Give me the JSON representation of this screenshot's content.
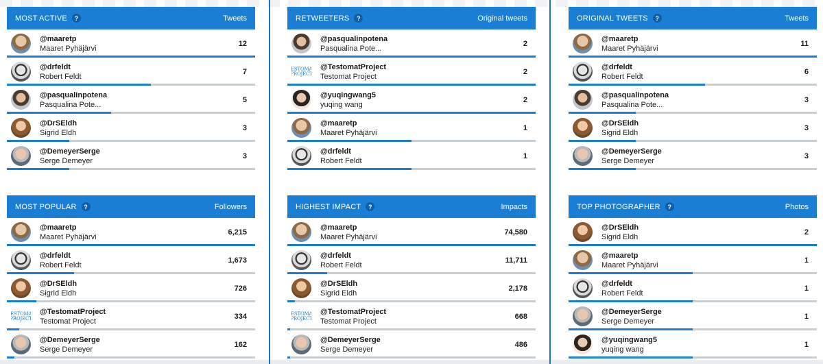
{
  "panels": [
    {
      "title": "MOST ACTIVE",
      "metric": "Tweets",
      "rows": [
        {
          "handle": "@maaretp",
          "name": "Maaret Pyhäjärvi",
          "value": "12",
          "fill": 1.0,
          "avatar": "a1"
        },
        {
          "handle": "@drfeldt",
          "name": "Robert Feldt",
          "value": "7",
          "fill": 0.58,
          "avatar": "a2"
        },
        {
          "handle": "@pasqualinpotena",
          "name": "Pasqualina Pote...",
          "value": "5",
          "fill": 0.42,
          "avatar": "a3"
        },
        {
          "handle": "@DrSEldh",
          "name": "Sigrid Eldh",
          "value": "3",
          "fill": 0.25,
          "avatar": "a4"
        },
        {
          "handle": "@DemeyerSerge",
          "name": "Serge Demeyer",
          "value": "3",
          "fill": 0.25,
          "avatar": "a5"
        }
      ]
    },
    {
      "title": "RETWEETERS",
      "metric": "Original tweets",
      "rows": [
        {
          "handle": "@pasqualinpotena",
          "name": "Pasqualina Pote...",
          "value": "2",
          "fill": 1.0,
          "avatar": "a3"
        },
        {
          "handle": "@TestomatProject",
          "name": "Testomat Project",
          "value": "2",
          "fill": 1.0,
          "avatar": "logo"
        },
        {
          "handle": "@yuqingwang5",
          "name": "yuqing wang",
          "value": "2",
          "fill": 1.0,
          "avatar": "a6"
        },
        {
          "handle": "@maaretp",
          "name": "Maaret Pyhäjärvi",
          "value": "1",
          "fill": 0.5,
          "avatar": "a1"
        },
        {
          "handle": "@drfeldt",
          "name": "Robert Feldt",
          "value": "1",
          "fill": 0.5,
          "avatar": "a2"
        }
      ]
    },
    {
      "title": "ORIGINAL TWEETS",
      "metric": "Tweets",
      "rows": [
        {
          "handle": "@maaretp",
          "name": "Maaret Pyhäjärvi",
          "value": "11",
          "fill": 1.0,
          "avatar": "a1"
        },
        {
          "handle": "@drfeldt",
          "name": "Robert Feldt",
          "value": "6",
          "fill": 0.55,
          "avatar": "a2"
        },
        {
          "handle": "@pasqualinpotena",
          "name": "Pasqualina Pote...",
          "value": "3",
          "fill": 0.27,
          "avatar": "a3"
        },
        {
          "handle": "@DrSEldh",
          "name": "Sigrid Eldh",
          "value": "3",
          "fill": 0.27,
          "avatar": "a4"
        },
        {
          "handle": "@DemeyerSerge",
          "name": "Serge Demeyer",
          "value": "3",
          "fill": 0.27,
          "avatar": "a5"
        }
      ]
    },
    {
      "title": "MOST POPULAR",
      "metric": "Followers",
      "rows": [
        {
          "handle": "@maaretp",
          "name": "Maaret Pyhäjärvi",
          "value": "6,215",
          "fill": 1.0,
          "avatar": "a1"
        },
        {
          "handle": "@drfeldt",
          "name": "Robert Feldt",
          "value": "1,673",
          "fill": 0.27,
          "avatar": "a2"
        },
        {
          "handle": "@DrSEldh",
          "name": "Sigrid Eldh",
          "value": "726",
          "fill": 0.12,
          "avatar": "a4"
        },
        {
          "handle": "@TestomatProject",
          "name": "Testomat Project",
          "value": "334",
          "fill": 0.05,
          "avatar": "logo"
        },
        {
          "handle": "@DemeyerSerge",
          "name": "Serge Demeyer",
          "value": "162",
          "fill": 0.03,
          "avatar": "a5"
        }
      ]
    },
    {
      "title": "HIGHEST IMPACT",
      "metric": "Impacts",
      "rows": [
        {
          "handle": "@maaretp",
          "name": "Maaret Pyhäjärvi",
          "value": "74,580",
          "fill": 1.0,
          "avatar": "a1"
        },
        {
          "handle": "@drfeldt",
          "name": "Robert Feldt",
          "value": "11,711",
          "fill": 0.16,
          "avatar": "a2"
        },
        {
          "handle": "@DrSEldh",
          "name": "Sigrid Eldh",
          "value": "2,178",
          "fill": 0.03,
          "avatar": "a4"
        },
        {
          "handle": "@TestomatProject",
          "name": "Testomat Project",
          "value": "668",
          "fill": 0.01,
          "avatar": "logo"
        },
        {
          "handle": "@DemeyerSerge",
          "name": "Serge Demeyer",
          "value": "486",
          "fill": 0.01,
          "avatar": "a5"
        }
      ]
    },
    {
      "title": "TOP PHOTOGRAPHER",
      "metric": "Photos",
      "rows": [
        {
          "handle": "@DrSEldh",
          "name": "Sigrid Eldh",
          "value": "2",
          "fill": 1.0,
          "avatar": "a4"
        },
        {
          "handle": "@maaretp",
          "name": "Maaret Pyhäjärvi",
          "value": "1",
          "fill": 0.5,
          "avatar": "a1"
        },
        {
          "handle": "@drfeldt",
          "name": "Robert Feldt",
          "value": "1",
          "fill": 0.5,
          "avatar": "a2"
        },
        {
          "handle": "@DemeyerSerge",
          "name": "Serge Demeyer",
          "value": "1",
          "fill": 0.5,
          "avatar": "a5"
        },
        {
          "handle": "@yuqingwang5",
          "name": "yuqing wang",
          "value": "1",
          "fill": 0.5,
          "avatar": "a6"
        }
      ]
    }
  ],
  "help_glyph": "?",
  "logo_text": [
    "TESTOMAT",
    "PROJECT"
  ],
  "colors": {
    "accent": "#1a7fd4",
    "track": "#c9ced3",
    "divider": "#1a73c9"
  }
}
